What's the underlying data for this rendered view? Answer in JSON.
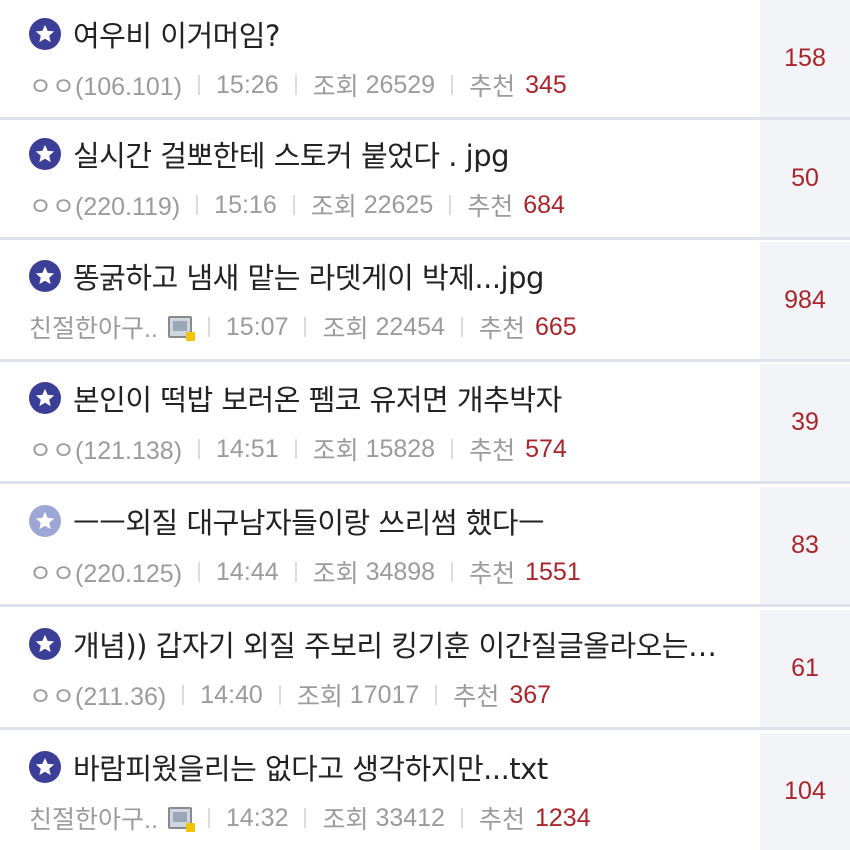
{
  "posts": [
    {
      "title": "여우비 이거머임?",
      "author": "ㅇㅇ(106.101)",
      "time": "15:26",
      "views_label": "조회",
      "views": "26529",
      "rec_label": "추천",
      "rec": "345",
      "comments": "158",
      "icon": "star-badge"
    },
    {
      "title": "실시간 걸뽀한테 스토커 붙었다 . jpg",
      "author": "ㅇㅇ(220.119)",
      "time": "15:16",
      "views_label": "조회",
      "views": "22625",
      "rec_label": "추천",
      "rec": "684",
      "comments": "50",
      "icon": "star-badge"
    },
    {
      "title": "똥굵하고 냄새 맡는 라뎃게이 박제...jpg",
      "author": "친절한아구..",
      "time": "15:07",
      "views_label": "조회",
      "views": "22454",
      "rec_label": "추천",
      "rec": "665",
      "comments": "984",
      "icon": "star-badge"
    },
    {
      "title": "본인이 떡밥 보러온 펨코 유저면 개추박자",
      "author": "ㅇㅇ(121.138)",
      "time": "14:51",
      "views_label": "조회",
      "views": "15828",
      "rec_label": "추천",
      "rec": "574",
      "comments": "39",
      "icon": "star-badge"
    },
    {
      "title": "ㅡㅡ외질 대구남자들이랑 쓰리썸 했다ㅡ",
      "author": "ㅇㅇ(220.125)",
      "time": "14:44",
      "views_label": "조회",
      "views": "34898",
      "rec_label": "추천",
      "rec": "1551",
      "comments": "83",
      "icon": "star-badge-light"
    },
    {
      "title": "개념)) 갑자기 외질 주보리 킹기훈 이간질글올라오는…",
      "author": "ㅇㅇ(211.36)",
      "time": "14:40",
      "views_label": "조회",
      "views": "17017",
      "rec_label": "추천",
      "rec": "367",
      "comments": "61",
      "icon": "star-badge"
    },
    {
      "title": "바람피웠을리는 없다고 생각하지만...txt",
      "author": "친절한아구..",
      "time": "14:32",
      "views_label": "조회",
      "views": "33412",
      "rec_label": "추천",
      "rec": "1234",
      "comments": "104",
      "icon": "star-badge"
    }
  ],
  "colors": {
    "accent": "#a8262b",
    "icon": "#3b3f98",
    "icon_light": "#9ea6d6",
    "divider": "#dfe2ec",
    "side_bg": "#f3f4f8"
  }
}
